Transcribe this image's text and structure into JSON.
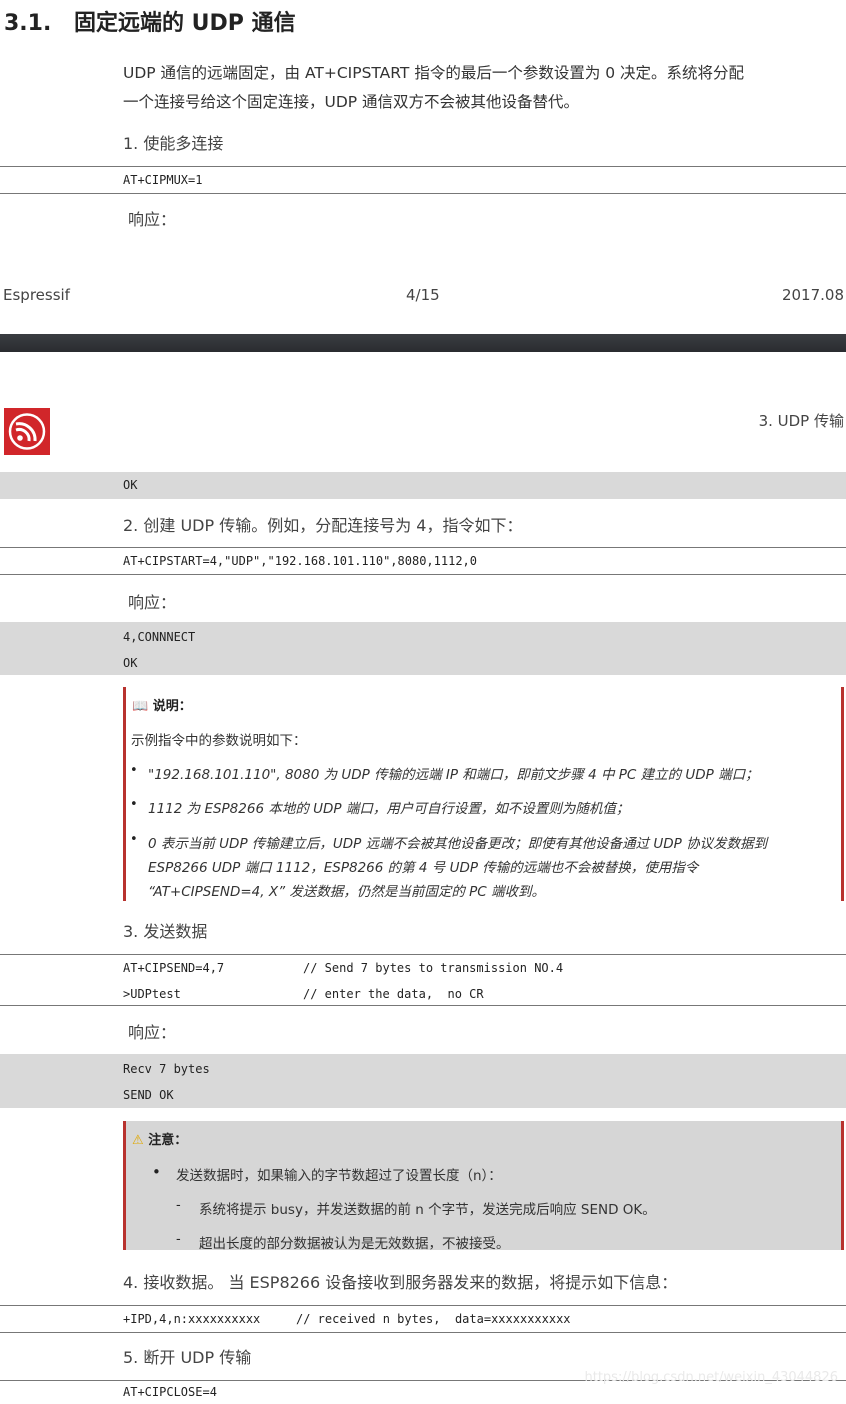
{
  "heading": {
    "number": "3.1.",
    "title": "固定远端的 UDP 通信"
  },
  "intro": [
    "UDP 通信的远端固定，由 AT+CIPSTART 指令的最后一个参数设置为 0 决定。系统将分配",
    "一个连接号给这个固定连接，UDP 通信双方不会被其他设备替代。"
  ],
  "step1": {
    "label": "1. 使能多连接",
    "command": "AT+CIPMUX=1"
  },
  "response_label": "响应：",
  "footer": {
    "company": "Espressif",
    "page": "4/15",
    "date": "2017.08"
  },
  "running_header": "3. UDP 传输",
  "step1_response": "OK",
  "step2": {
    "label": "2. 创建 UDP 传输。例如，分配连接号为 4，指令如下：",
    "command": "AT+CIPSTART=4,\"UDP\",\"192.168.101.110\",8080,1112,0",
    "response": [
      "4,CONNNECT",
      "OK"
    ]
  },
  "note": {
    "title": "说明：",
    "intro": "示例指令中的参数说明如下：",
    "bullets": [
      [
        "\"192.168.101.110\", 8080 为 UDP 传输的远端 IP 和端口，即前文步骤 4 中 PC 建立的 UDP 端口；"
      ],
      [
        "1112 为 ESP8266 本地的 UDP 端口，用户可自行设置，如不设置则为随机值；"
      ],
      [
        "0 表示当前 UDP 传输建立后，UDP 远端不会被其他设备更改；即使有其他设备通过 UDP 协议发数据到",
        "ESP8266 UDP 端口 1112，ESP8266 的第 4 号 UDP 传输的远端也不会被替换，使用指令",
        "“AT+CIPSEND=4, X” 发送数据，仍然是当前固定的 PC 端收到。"
      ]
    ]
  },
  "step3": {
    "label": "3. 发送数据",
    "lines": [
      {
        "cmd": "AT+CIPSEND=4,7",
        "comment": "// Send 7 bytes to transmission NO.4"
      },
      {
        "cmd": ">UDPtest",
        "comment": "// enter the data,  no CR"
      }
    ],
    "response": [
      "Recv 7 bytes",
      "SEND OK"
    ]
  },
  "warning": {
    "title": "注意：",
    "bullet": "发送数据时，如果输入的字节数超过了设置长度（n）：",
    "subs": [
      "系统将提示 busy，并发送数据的前 n 个字节，发送完成后响应 SEND OK。",
      "超出长度的部分数据被认为是无效数据，不被接受。"
    ]
  },
  "step4": {
    "label": "4. 接收数据。 当 ESP8266 设备接收到服务器发来的数据，将提示如下信息：",
    "cmd": "+IPD,4,n:xxxxxxxxxx",
    "comment": "// received n bytes,  data=xxxxxxxxxxx"
  },
  "step5": {
    "label": "5. 断开 UDP 传输",
    "command": "AT+CIPCLOSE=4"
  },
  "watermark": "https://blog.csdn.net/weixin_43044826"
}
